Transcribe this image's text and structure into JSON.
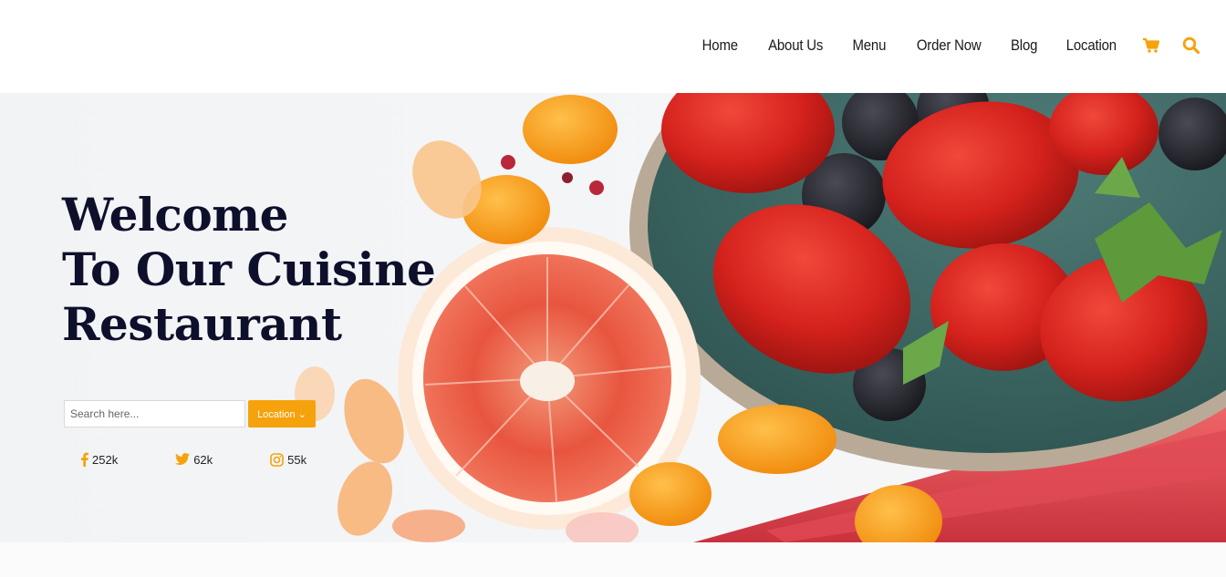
{
  "nav": {
    "links": [
      "Home",
      "About Us",
      "Menu",
      "Order Now",
      "Blog",
      "Location"
    ],
    "icons": [
      "cart-icon",
      "search-icon"
    ]
  },
  "hero": {
    "title_lines": [
      "Welcome",
      "To Our Cuisine",
      "Restaurant"
    ],
    "search_placeholder": "Search here...",
    "location_label": "Location ⌄"
  },
  "social": [
    {
      "icon": "facebook-icon",
      "count": "252k"
    },
    {
      "icon": "twitter-icon",
      "count": "62k"
    },
    {
      "icon": "instagram-icon",
      "count": "55k"
    }
  ],
  "colors": {
    "accent": "#f6a20c",
    "title": "#0d0f2b",
    "nav_text": "#1a1a1a"
  }
}
